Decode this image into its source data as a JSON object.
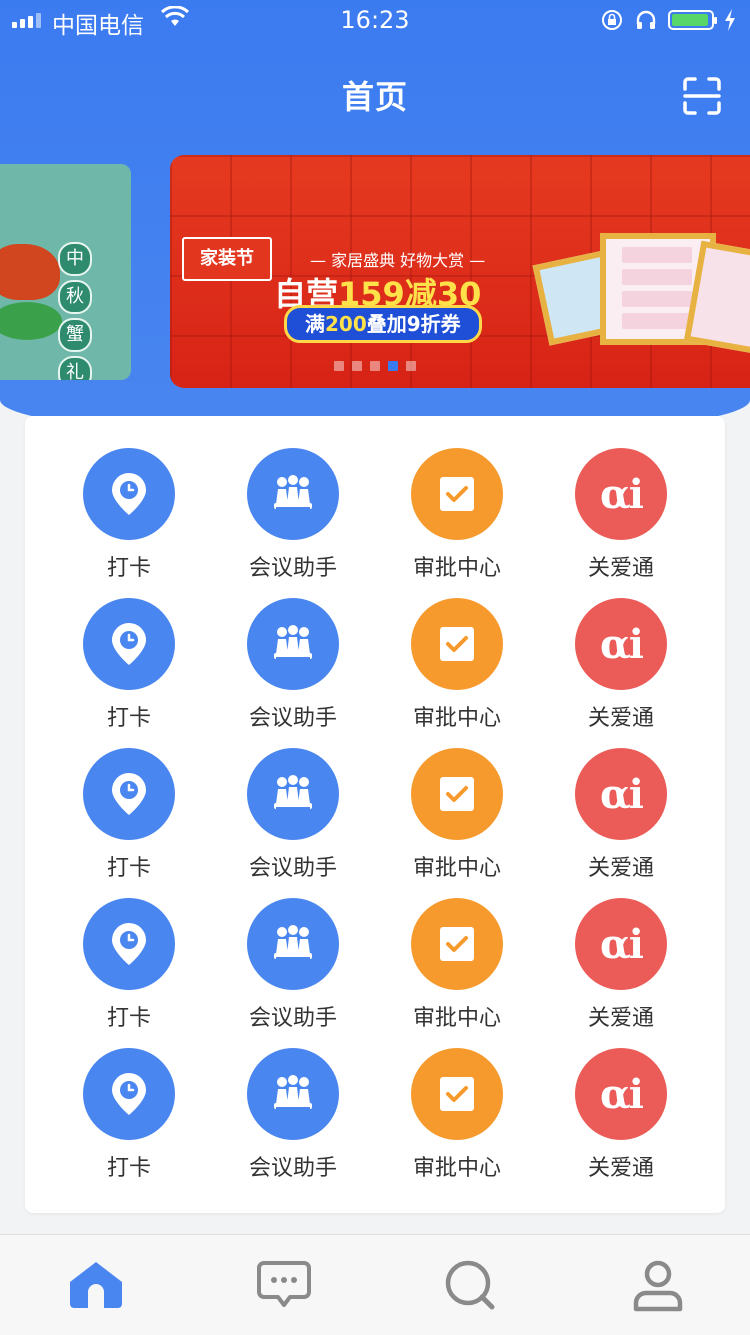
{
  "status_bar": {
    "carrier": "中国电信",
    "time": "16:23"
  },
  "header": {
    "title": "首页",
    "scan_icon": "scan-icon"
  },
  "banner": {
    "prev_slide_text": [
      "中",
      "秋",
      "蟹",
      "礼"
    ],
    "brand_badge": "家装节",
    "tagline": "— 家居盛典 好物大赏 —",
    "headline_prefix": "自营",
    "headline_highlight": "159减30",
    "coupon_prefix": "满",
    "coupon_highlight": "200",
    "coupon_suffix": "叠加9折券",
    "dot_count": 5,
    "active_dot": 4
  },
  "apps": {
    "rows": [
      [
        {
          "label": "打卡",
          "icon": "location-clock-icon",
          "color": "#4a86f0"
        },
        {
          "label": "会议助手",
          "icon": "meeting-icon",
          "color": "#4a86f0"
        },
        {
          "label": "审批中心",
          "icon": "approval-check-icon",
          "color": "#f79a2e"
        },
        {
          "label": "关爱通",
          "icon": "ai-icon",
          "color": "#eb5b57"
        }
      ],
      [
        {
          "label": "打卡",
          "icon": "location-clock-icon",
          "color": "#4a86f0"
        },
        {
          "label": "会议助手",
          "icon": "meeting-icon",
          "color": "#4a86f0"
        },
        {
          "label": "审批中心",
          "icon": "approval-check-icon",
          "color": "#f79a2e"
        },
        {
          "label": "关爱通",
          "icon": "ai-icon",
          "color": "#eb5b57"
        }
      ],
      [
        {
          "label": "打卡",
          "icon": "location-clock-icon",
          "color": "#4a86f0"
        },
        {
          "label": "会议助手",
          "icon": "meeting-icon",
          "color": "#4a86f0"
        },
        {
          "label": "审批中心",
          "icon": "approval-check-icon",
          "color": "#f79a2e"
        },
        {
          "label": "关爱通",
          "icon": "ai-icon",
          "color": "#eb5b57"
        }
      ],
      [
        {
          "label": "打卡",
          "icon": "location-clock-icon",
          "color": "#4a86f0"
        },
        {
          "label": "会议助手",
          "icon": "meeting-icon",
          "color": "#4a86f0"
        },
        {
          "label": "审批中心",
          "icon": "approval-check-icon",
          "color": "#f79a2e"
        },
        {
          "label": "关爱通",
          "icon": "ai-icon",
          "color": "#eb5b57"
        }
      ],
      [
        {
          "label": "打卡",
          "icon": "location-clock-icon",
          "color": "#4a86f0"
        },
        {
          "label": "会议助手",
          "icon": "meeting-icon",
          "color": "#4a86f0"
        },
        {
          "label": "审批中心",
          "icon": "approval-check-icon",
          "color": "#f79a2e"
        },
        {
          "label": "关爱通",
          "icon": "ai-icon",
          "color": "#eb5b57"
        }
      ]
    ],
    "ai_glyph": "αi"
  },
  "tab_bar": {
    "tabs": [
      {
        "icon": "home-icon",
        "active": true,
        "color": "#4a86f0"
      },
      {
        "icon": "message-icon",
        "active": false,
        "color": "#8a8a8a"
      },
      {
        "icon": "discover-icon",
        "active": false,
        "color": "#8a8a8a"
      },
      {
        "icon": "profile-icon",
        "active": false,
        "color": "#8a8a8a"
      }
    ]
  },
  "colors": {
    "primary": "#3b7bf0",
    "orange": "#f79a2e",
    "red": "#eb5b57",
    "battery": "#58d66a"
  }
}
